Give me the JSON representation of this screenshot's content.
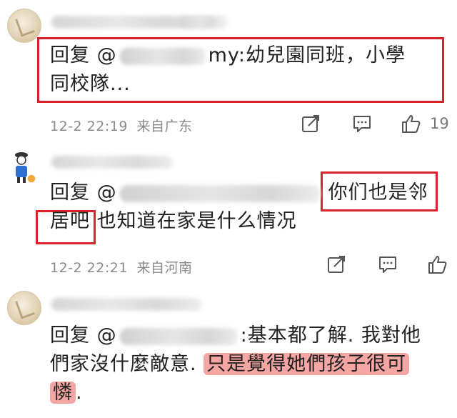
{
  "comments": [
    {
      "reply_prefix": "回复 @",
      "mention_suffix": "my:",
      "content_line1": "幼兒園同班，小學",
      "content_line2": "同校隊...",
      "date": "12-2 22:19",
      "location": "来自广东",
      "like_count": "19"
    },
    {
      "reply_prefix": "回复 @",
      "content_highlight_a": "你们也是邻",
      "content_highlight_b": "居吧",
      "content_rest": " 也知道在家是什么情况",
      "date": "12-2 22:21",
      "location": "来自河南"
    },
    {
      "reply_prefix": "回复 @",
      "content_line1": ":基本都了解. 我對他",
      "content_line2_plain": "們家沒什麼敵意. ",
      "content_line2_highlight": "只是覺得她們孩子很可",
      "content_line3_highlight": "憐",
      "content_line3_tail": "."
    }
  ],
  "colors": {
    "annotation_red": "#d9232a",
    "highlight_pink": "#f3a6a3",
    "meta_gray": "#8a8a8a"
  },
  "icons": [
    "share-icon",
    "comment-icon",
    "like-icon"
  ]
}
